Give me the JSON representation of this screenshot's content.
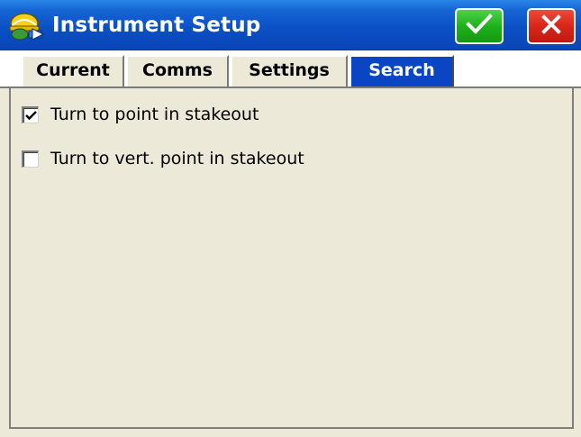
{
  "window": {
    "title": "Instrument Setup",
    "icon": "instrument-app-icon",
    "ok_icon": "checkmark-icon",
    "close_icon": "close-x-icon",
    "colors": {
      "titlebar": "#0a4fc4",
      "ok": "#1eb21a",
      "close": "#d8261a",
      "active_tab": "#0a46c4",
      "background": "#ece9d8"
    }
  },
  "tabs": [
    {
      "label": "Current",
      "active": false
    },
    {
      "label": "Comms",
      "active": false
    },
    {
      "label": "Settings",
      "active": false
    },
    {
      "label": "Search",
      "active": true
    }
  ],
  "search": {
    "options": [
      {
        "label": "Turn to point in stakeout",
        "checked": true
      },
      {
        "label": "Turn to vert. point in stakeout",
        "checked": false
      }
    ]
  }
}
